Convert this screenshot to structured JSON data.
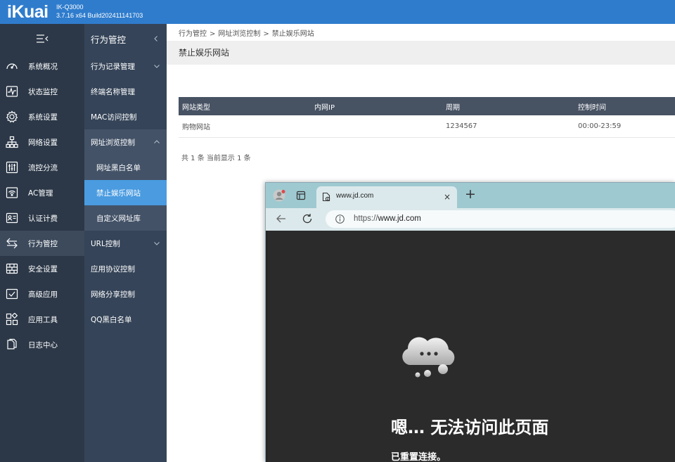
{
  "app": {
    "logo": "iKuai",
    "model": "IK-Q3000",
    "version": "3.7.16 x64 Build202411141703"
  },
  "sidebar": {
    "items": [
      {
        "label": "系统概况",
        "icon": "dashboard-icon"
      },
      {
        "label": "状态监控",
        "icon": "monitor-pulse-icon"
      },
      {
        "label": "系统设置",
        "icon": "gear-icon"
      },
      {
        "label": "网络设置",
        "icon": "network-tree-icon"
      },
      {
        "label": "流控分流",
        "icon": "sliders-icon"
      },
      {
        "label": "AC管理",
        "icon": "wifi-icon"
      },
      {
        "label": "认证计费",
        "icon": "id-card-icon"
      },
      {
        "label": "行为管控",
        "icon": "swap-arrows-icon"
      },
      {
        "label": "安全设置",
        "icon": "firewall-icon"
      },
      {
        "label": "高级应用",
        "icon": "checkbox-app-icon"
      },
      {
        "label": "应用工具",
        "icon": "apps-grid-icon"
      },
      {
        "label": "日志中心",
        "icon": "document-icon"
      }
    ]
  },
  "subnav": {
    "title": "行为管控",
    "items": [
      {
        "label": "行为记录管理"
      },
      {
        "label": "终端名称管理"
      },
      {
        "label": "MAC访问控制"
      },
      {
        "label": "网址浏览控制"
      },
      {
        "label": "网址黑白名单"
      },
      {
        "label": "禁止娱乐网站"
      },
      {
        "label": "自定义网址库"
      },
      {
        "label": "URL控制"
      },
      {
        "label": "应用协议控制"
      },
      {
        "label": "网络分享控制"
      },
      {
        "label": "QQ黑白名单"
      }
    ]
  },
  "main": {
    "breadcrumb": [
      "行为管控",
      "网址浏览控制",
      "禁止娱乐网站"
    ],
    "breadcrumb_sep": ">",
    "page_title": "禁止娱乐网站",
    "table": {
      "headers": [
        "网站类型",
        "内网IP",
        "周期",
        "控制时间"
      ],
      "rows": [
        [
          "购物网站",
          "",
          "1234567",
          "00:00-23:59"
        ]
      ]
    },
    "footer": "共 1 条 当前显示 1 条"
  },
  "browser": {
    "tab_title": "www.jd.com",
    "tab_close": "×",
    "new_tab": "+",
    "url_prefix": "https://",
    "url_host": "www.jd.com",
    "error_title": "嗯… 无法访问此页面",
    "error_sub": "已重置连接。"
  },
  "colors": {
    "topbar": "#2f7ccd",
    "sidebar": "#2c3848",
    "subnav": "#354458",
    "active_sub": "#4a9be0",
    "table_header": "#475263"
  }
}
